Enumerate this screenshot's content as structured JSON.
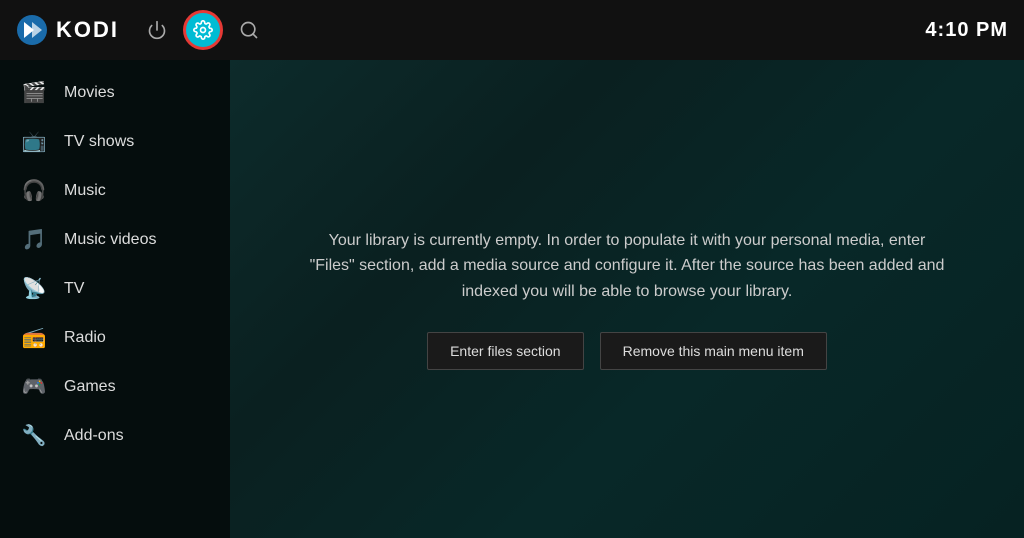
{
  "topbar": {
    "logo_text": "KODI",
    "time": "4:10 PM"
  },
  "sidebar": {
    "items": [
      {
        "id": "movies",
        "label": "Movies",
        "icon": "🎬"
      },
      {
        "id": "tv-shows",
        "label": "TV shows",
        "icon": "📺"
      },
      {
        "id": "music",
        "label": "Music",
        "icon": "🎧"
      },
      {
        "id": "music-videos",
        "label": "Music videos",
        "icon": "🎵"
      },
      {
        "id": "tv",
        "label": "TV",
        "icon": "📡"
      },
      {
        "id": "radio",
        "label": "Radio",
        "icon": "📻"
      },
      {
        "id": "games",
        "label": "Games",
        "icon": "🎮"
      },
      {
        "id": "add-ons",
        "label": "Add-ons",
        "icon": "🔧"
      }
    ]
  },
  "content": {
    "message": "Your library is currently empty. In order to populate it with your personal media, enter \"Files\" section, add a media source and configure it. After the source has been added and indexed you will be able to browse your library.",
    "button_enter_files": "Enter files section",
    "button_remove_item": "Remove this main menu item"
  }
}
